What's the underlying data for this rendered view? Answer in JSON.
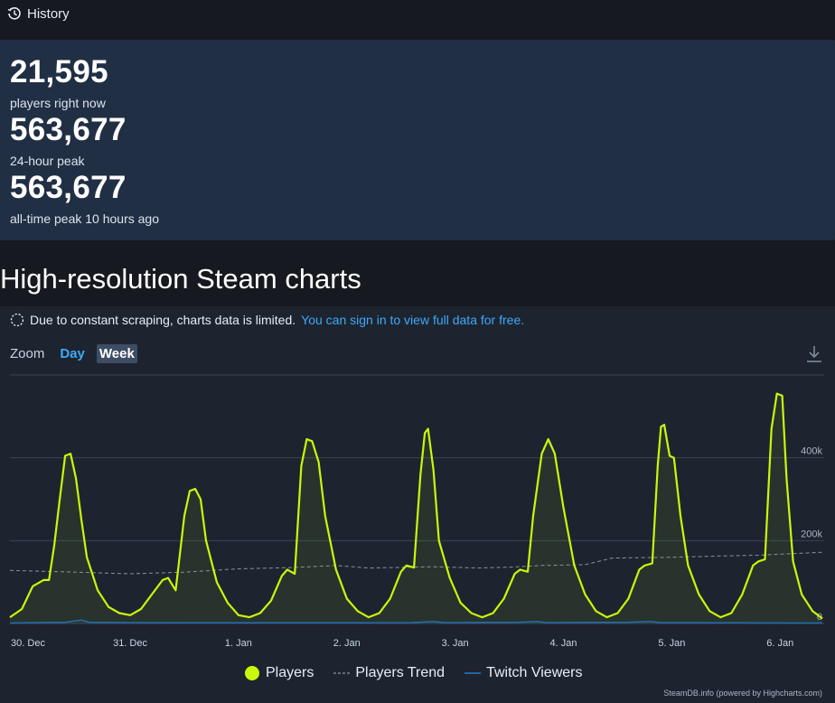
{
  "history": {
    "label": "History",
    "icon": "history-icon"
  },
  "stats": [
    {
      "value": "21,595",
      "label": "players right now"
    },
    {
      "value": "563,677",
      "label": "24-hour peak"
    },
    {
      "value": "563,677",
      "label": "all-time peak 10 hours ago"
    }
  ],
  "heading": "High-resolution Steam charts",
  "notice": {
    "text": "Due to constant scraping, charts data is limited.",
    "link": "You can sign in to view full data for free."
  },
  "zoom": {
    "label": "Zoom",
    "options": [
      "Day",
      "Week"
    ],
    "selected": "Week"
  },
  "credit": "SteamDB.info (powered by Highcharts.com)",
  "colors": {
    "players": "#c9f80a",
    "trend": "#9aa3ad",
    "twitch": "#1f6fb5",
    "accent": "#3fa9f5"
  },
  "chart_data": {
    "type": "line",
    "x_labels": [
      "30. Dec",
      "31. Dec",
      "1. Jan",
      "2. Jan",
      "3. Jan",
      "4. Jan",
      "5. Jan",
      "6. Jan"
    ],
    "y_ticks": [
      "0",
      "200k",
      "400k"
    ],
    "ylim": [
      0,
      600000
    ],
    "x_range_days": [
      -0.11,
      7.04
    ],
    "grid": true,
    "legend": "bottom",
    "series": [
      {
        "name": "Players",
        "points": [
          [
            -0.11,
            15000
          ],
          [
            0.0,
            35000
          ],
          [
            0.1,
            90000
          ],
          [
            0.2,
            105000
          ],
          [
            0.25,
            105000
          ],
          [
            0.3,
            190000
          ],
          [
            0.35,
            300000
          ],
          [
            0.4,
            405000
          ],
          [
            0.45,
            410000
          ],
          [
            0.5,
            350000
          ],
          [
            0.55,
            250000
          ],
          [
            0.6,
            160000
          ],
          [
            0.7,
            80000
          ],
          [
            0.8,
            40000
          ],
          [
            0.9,
            25000
          ],
          [
            1.0,
            20000
          ],
          [
            1.1,
            35000
          ],
          [
            1.2,
            70000
          ],
          [
            1.3,
            105000
          ],
          [
            1.35,
            110000
          ],
          [
            1.42,
            80000
          ],
          [
            1.5,
            260000
          ],
          [
            1.55,
            320000
          ],
          [
            1.6,
            325000
          ],
          [
            1.65,
            300000
          ],
          [
            1.7,
            200000
          ],
          [
            1.8,
            100000
          ],
          [
            1.9,
            50000
          ],
          [
            2.0,
            20000
          ],
          [
            2.1,
            15000
          ],
          [
            2.2,
            25000
          ],
          [
            2.3,
            55000
          ],
          [
            2.4,
            115000
          ],
          [
            2.45,
            130000
          ],
          [
            2.52,
            120000
          ],
          [
            2.58,
            380000
          ],
          [
            2.63,
            445000
          ],
          [
            2.68,
            440000
          ],
          [
            2.74,
            390000
          ],
          [
            2.8,
            260000
          ],
          [
            2.9,
            130000
          ],
          [
            3.0,
            60000
          ],
          [
            3.1,
            30000
          ],
          [
            3.2,
            15000
          ],
          [
            3.3,
            25000
          ],
          [
            3.4,
            60000
          ],
          [
            3.5,
            125000
          ],
          [
            3.55,
            140000
          ],
          [
            3.62,
            135000
          ],
          [
            3.68,
            360000
          ],
          [
            3.72,
            460000
          ],
          [
            3.75,
            470000
          ],
          [
            3.8,
            370000
          ],
          [
            3.85,
            200000
          ],
          [
            3.95,
            110000
          ],
          [
            4.05,
            50000
          ],
          [
            4.15,
            25000
          ],
          [
            4.25,
            15000
          ],
          [
            4.35,
            25000
          ],
          [
            4.45,
            60000
          ],
          [
            4.55,
            120000
          ],
          [
            4.6,
            130000
          ],
          [
            4.67,
            125000
          ],
          [
            4.72,
            260000
          ],
          [
            4.8,
            410000
          ],
          [
            4.86,
            445000
          ],
          [
            4.92,
            410000
          ],
          [
            5.0,
            280000
          ],
          [
            5.1,
            140000
          ],
          [
            5.2,
            70000
          ],
          [
            5.3,
            30000
          ],
          [
            5.4,
            15000
          ],
          [
            5.5,
            25000
          ],
          [
            5.6,
            60000
          ],
          [
            5.7,
            130000
          ],
          [
            5.75,
            140000
          ],
          [
            5.82,
            145000
          ],
          [
            5.87,
            380000
          ],
          [
            5.9,
            475000
          ],
          [
            5.93,
            480000
          ],
          [
            5.98,
            405000
          ],
          [
            6.02,
            400000
          ],
          [
            6.08,
            260000
          ],
          [
            6.15,
            140000
          ],
          [
            6.25,
            70000
          ],
          [
            6.35,
            30000
          ],
          [
            6.45,
            15000
          ],
          [
            6.55,
            25000
          ],
          [
            6.65,
            70000
          ],
          [
            6.75,
            140000
          ],
          [
            6.8,
            150000
          ],
          [
            6.86,
            155000
          ],
          [
            6.92,
            470000
          ],
          [
            6.97,
            555000
          ],
          [
            7.02,
            550000
          ],
          [
            7.06,
            350000
          ],
          [
            7.12,
            150000
          ],
          [
            7.2,
            70000
          ],
          [
            7.3,
            30000
          ],
          [
            7.39,
            12000
          ]
        ]
      },
      {
        "name": "Players Trend",
        "points": [
          [
            -0.11,
            128000
          ],
          [
            0.5,
            124000
          ],
          [
            1.0,
            120000
          ],
          [
            1.5,
            124000
          ],
          [
            2.0,
            132000
          ],
          [
            2.5,
            135000
          ],
          [
            2.9,
            140000
          ],
          [
            3.2,
            134000
          ],
          [
            3.8,
            137000
          ],
          [
            4.2,
            134000
          ],
          [
            4.5,
            136000
          ],
          [
            4.8,
            140000
          ],
          [
            5.2,
            142000
          ],
          [
            5.45,
            158000
          ],
          [
            6.0,
            160000
          ],
          [
            6.45,
            163000
          ],
          [
            6.8,
            165000
          ],
          [
            7.39,
            172000
          ]
        ]
      },
      {
        "name": "Twitch Viewers",
        "points": [
          [
            -0.11,
            1000
          ],
          [
            0.4,
            3000
          ],
          [
            0.55,
            8000
          ],
          [
            0.62,
            3000
          ],
          [
            1.0,
            2000
          ],
          [
            1.6,
            1500
          ],
          [
            2.4,
            1500
          ],
          [
            3.6,
            2000
          ],
          [
            3.8,
            5000
          ],
          [
            3.9,
            2000
          ],
          [
            4.6,
            3000
          ],
          [
            4.75,
            5000
          ],
          [
            4.85,
            2000
          ],
          [
            5.6,
            3000
          ],
          [
            5.8,
            5000
          ],
          [
            5.9,
            2000
          ],
          [
            6.6,
            1500
          ],
          [
            7.39,
            1000
          ]
        ]
      }
    ]
  }
}
